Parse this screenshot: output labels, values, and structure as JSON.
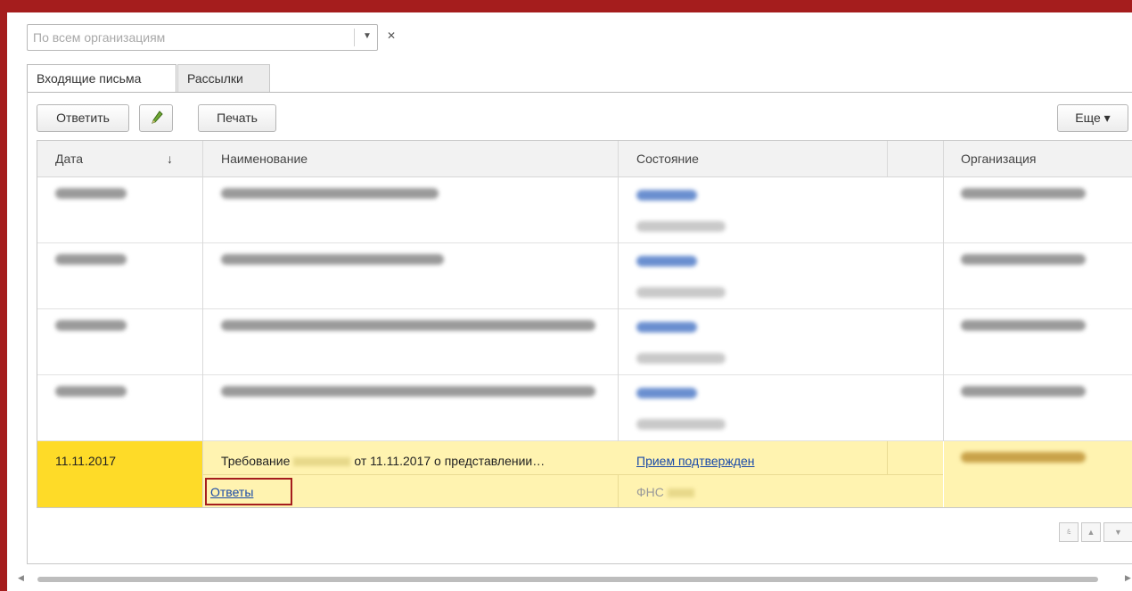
{
  "filter": {
    "placeholder": "По всем организациям"
  },
  "tabs": [
    {
      "label": "Входящие письма",
      "active": true
    },
    {
      "label": "Рассылки",
      "active": false
    }
  ],
  "toolbar": {
    "reply_label": "Ответить",
    "print_label": "Печать",
    "more_label": "Еще ▾"
  },
  "table": {
    "columns": [
      "Дата",
      "Наименование",
      "Состояние",
      "Организация"
    ],
    "sort_indicator": "↓",
    "selected_row": {
      "date": "11.11.2017",
      "name_prefix": "Требование",
      "name_suffix": "от 11.11.2017 о представлении…",
      "replies_link": "Ответы",
      "status": "Прием подтвержден",
      "recipient": "ФНС"
    }
  },
  "colors": {
    "frame": "#a51d1d",
    "selected_date": "#fedb28",
    "selected_row": "#fff3b0",
    "link": "#1b4ba8"
  },
  "icons": [
    "dropdown-arrow-icon",
    "clear-icon",
    "pencil-icon",
    "first-page-icon",
    "scroll-up-icon",
    "scroll-down-icon"
  ]
}
